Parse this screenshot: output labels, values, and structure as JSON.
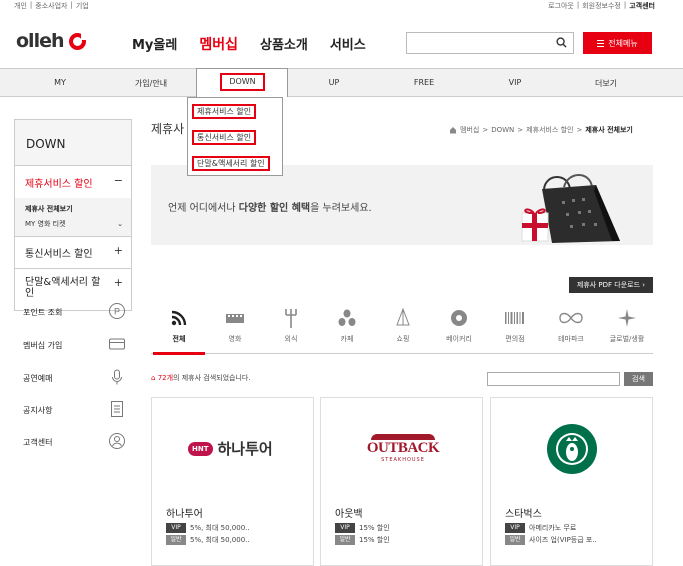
{
  "util": {
    "left": [
      "개인",
      "중소사업자",
      "기업"
    ],
    "right": [
      "로그아웃",
      "회원정보수정"
    ],
    "cs": "고객센터"
  },
  "header": {
    "logo": "olleh",
    "gnb": [
      "My올레",
      "멤버십",
      "상품소개",
      "서비스"
    ],
    "all_menu": "전체메뉴"
  },
  "subnav": {
    "items": [
      "MY",
      "가입/안내",
      "DOWN",
      "UP",
      "FREE",
      "VIP",
      "더보기"
    ]
  },
  "dropdown": [
    "제휴서비스 할인",
    "통신서비스 할인",
    "단말&액세서리 할인"
  ],
  "lnb": {
    "head": "DOWN",
    "selected": "제휴서비스 할인",
    "minus": "−",
    "sub": [
      "제휴사 전체보기",
      "MY 영화 티켓"
    ],
    "groups": [
      "통신서비스 할인",
      "단말&액세서리 할인"
    ],
    "plus": "+",
    "quick": [
      "포인트 조회",
      "멤버십 가입",
      "공연예매",
      "공지사항",
      "고객센터"
    ]
  },
  "main": {
    "title": "제휴사",
    "breadcrumb": [
      "멤버십",
      "DOWN",
      "제휴서비스 할인",
      "제휴사 전체보기"
    ],
    "banner_pre": "언제 어디에서나 ",
    "banner_bold": "다양한 할인 혜택",
    "banner_post": "을 누려보세요.",
    "pdf": "제휴사 PDF 다운로드",
    "cats": [
      "전체",
      "영화",
      "외식",
      "카페",
      "쇼핑",
      "베이커리",
      "편의점",
      "테마파크",
      "글로벌/생활"
    ],
    "count_num": "72개",
    "count_post": "의 제휴사 검색되었습니다.",
    "search_btn": "검색",
    "cards": [
      {
        "logo": "하나투어",
        "logo_badge": "HNT",
        "name": "하나투어",
        "vip": "5%, 최대 50,000..",
        "gen": "5%, 최대 50,000.."
      },
      {
        "logo": "OUTBACK",
        "logo_sub": "STEAKHOUSE",
        "name": "아웃백",
        "vip": "15% 할인",
        "gen": "15% 할인"
      },
      {
        "name": "스타벅스",
        "vip": "아메리카노 무료",
        "gen": "사이즈 업(VIP등급 포.."
      }
    ],
    "tag_vip": "VIP",
    "tag_gen": "일반"
  }
}
